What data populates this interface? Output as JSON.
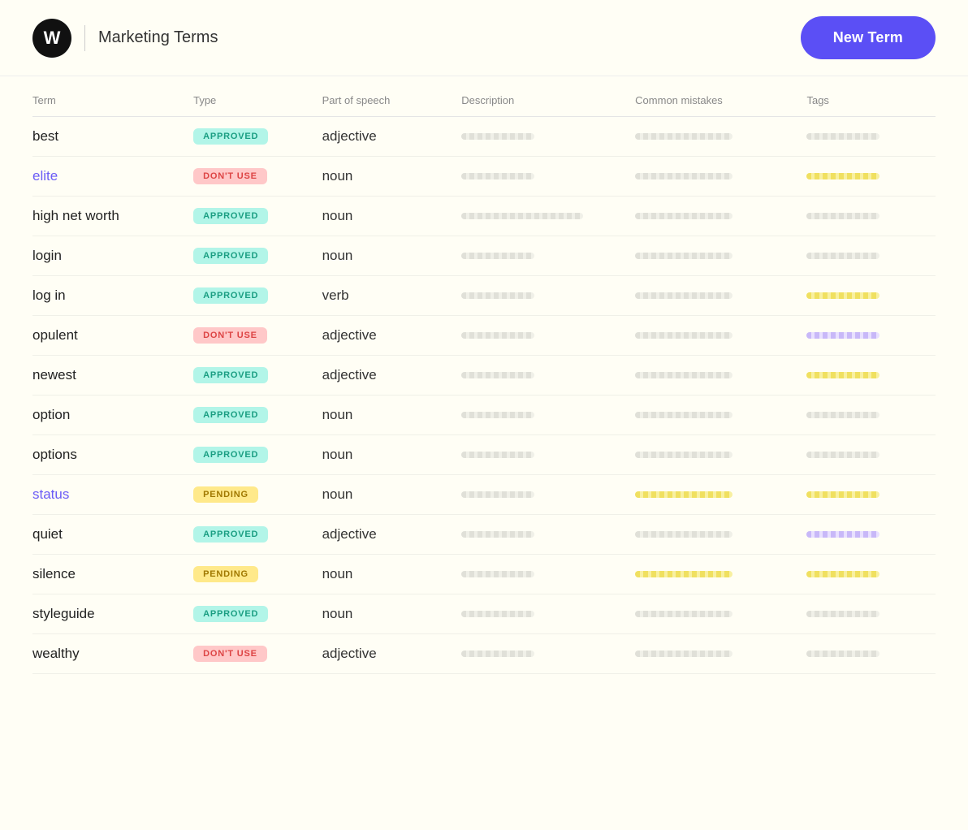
{
  "header": {
    "logo_letter": "W",
    "title": "Marketing Terms",
    "new_term_label": "New Term"
  },
  "table": {
    "columns": [
      "Term",
      "Type",
      "Part of speech",
      "Description",
      "Common mistakes",
      "Tags"
    ],
    "rows": [
      {
        "term": "best",
        "term_purple": false,
        "type": "APPROVED",
        "pos": "adjective",
        "desc": "sm",
        "mistakes": "md",
        "mistakes_color": "",
        "tags": "sm",
        "tags_color": ""
      },
      {
        "term": "elite",
        "term_purple": true,
        "type": "DON'T USE",
        "pos": "noun",
        "desc": "sm",
        "mistakes": "md",
        "mistakes_color": "",
        "tags": "yellow",
        "tags_color": "yellow"
      },
      {
        "term": "high net worth",
        "term_purple": false,
        "type": "APPROVED",
        "pos": "noun",
        "desc": "lg",
        "mistakes": "md",
        "mistakes_color": "",
        "tags": "sm",
        "tags_color": ""
      },
      {
        "term": "login",
        "term_purple": false,
        "type": "APPROVED",
        "pos": "noun",
        "desc": "sm",
        "mistakes": "md",
        "mistakes_color": "",
        "tags": "sm",
        "tags_color": ""
      },
      {
        "term": "log in",
        "term_purple": false,
        "type": "APPROVED",
        "pos": "verb",
        "desc": "sm",
        "mistakes": "md",
        "mistakes_color": "",
        "tags": "yellow",
        "tags_color": "yellow"
      },
      {
        "term": "opulent",
        "term_purple": false,
        "type": "DON'T USE",
        "pos": "adjective",
        "desc": "sm",
        "mistakes": "md",
        "mistakes_color": "",
        "tags": "purple",
        "tags_color": "purple"
      },
      {
        "term": "newest",
        "term_purple": false,
        "type": "APPROVED",
        "pos": "adjective",
        "desc": "sm",
        "mistakes": "md",
        "mistakes_color": "",
        "tags": "yellow",
        "tags_color": "yellow"
      },
      {
        "term": "option",
        "term_purple": false,
        "type": "APPROVED",
        "pos": "noun",
        "desc": "sm",
        "mistakes": "md",
        "mistakes_color": "",
        "tags": "sm",
        "tags_color": ""
      },
      {
        "term": "options",
        "term_purple": false,
        "type": "APPROVED",
        "pos": "noun",
        "desc": "sm",
        "mistakes": "md",
        "mistakes_color": "",
        "tags": "sm",
        "tags_color": ""
      },
      {
        "term": "status",
        "term_purple": true,
        "type": "PENDING",
        "pos": "noun",
        "desc": "sm",
        "mistakes": "yellow",
        "mistakes_color": "yellow",
        "tags": "yellow",
        "tags_color": "yellow"
      },
      {
        "term": "quiet",
        "term_purple": false,
        "type": "APPROVED",
        "pos": "adjective",
        "desc": "sm",
        "mistakes": "md",
        "mistakes_color": "",
        "tags": "purple",
        "tags_color": "purple"
      },
      {
        "term": "silence",
        "term_purple": false,
        "type": "PENDING",
        "pos": "noun",
        "desc": "sm",
        "mistakes": "yellow",
        "mistakes_color": "yellow",
        "tags": "yellow",
        "tags_color": "yellow"
      },
      {
        "term": "styleguide",
        "term_purple": false,
        "type": "APPROVED",
        "pos": "noun",
        "desc": "sm",
        "mistakes": "md",
        "mistakes_color": "",
        "tags": "sm",
        "tags_color": ""
      },
      {
        "term": "wealthy",
        "term_purple": false,
        "type": "DON'T USE",
        "pos": "adjective",
        "desc": "sm",
        "mistakes": "md",
        "mistakes_color": "",
        "tags": "sm",
        "tags_color": ""
      }
    ]
  }
}
